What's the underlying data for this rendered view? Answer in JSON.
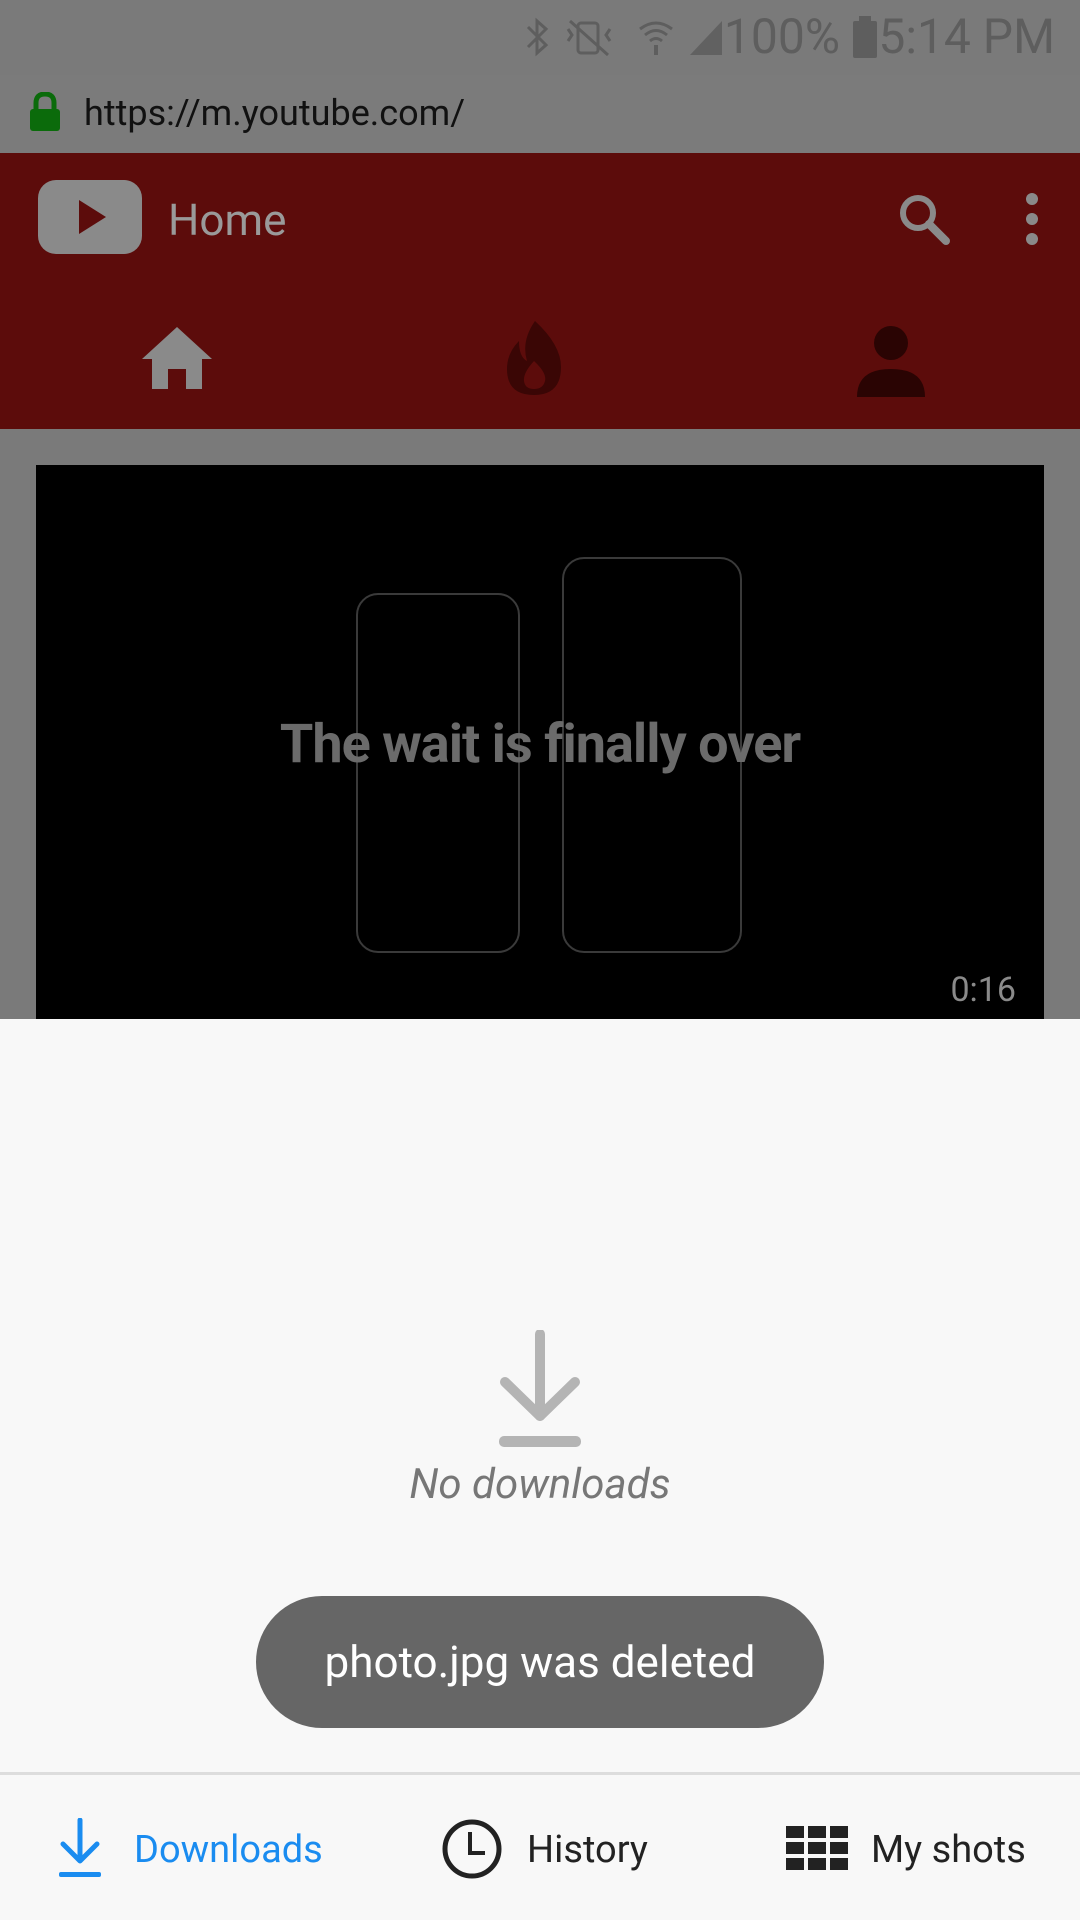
{
  "status_bar": {
    "battery_percent": "100%",
    "time": "5:14 PM"
  },
  "browser": {
    "url": "https://m.youtube.com/"
  },
  "youtube": {
    "title": "Home",
    "video": {
      "overlay_text": "The wait is finally over",
      "duration": "0:16"
    }
  },
  "downloads_panel": {
    "empty_text": "No downloads",
    "toast_text": "photo.jpg was deleted"
  },
  "bottom_nav": {
    "items": [
      {
        "label": "Downloads",
        "icon": "download-icon",
        "active": true
      },
      {
        "label": "History",
        "icon": "clock-icon",
        "active": false
      },
      {
        "label": "My shots",
        "icon": "grid-icon",
        "active": false
      }
    ]
  },
  "colors": {
    "accent": "#1a8cf0",
    "toast_bg": "#666666",
    "youtube_header_dimmed": "#5c0c0b"
  }
}
